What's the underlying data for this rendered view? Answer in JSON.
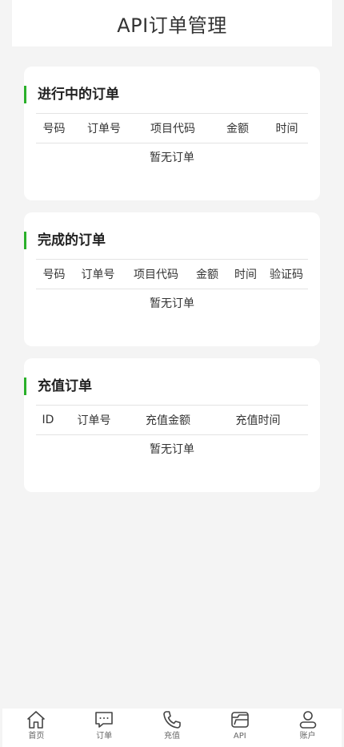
{
  "header": {
    "title": "API订单管理"
  },
  "sections": [
    {
      "title": "进行中的订单",
      "columns": [
        "号码",
        "订单号",
        "项目代码",
        "金额",
        "时间"
      ],
      "empty_text": "暂无订单"
    },
    {
      "title": "完成的订单",
      "columns": [
        "号码",
        "订单号",
        "项目代码",
        "金额",
        "时间",
        "验证码"
      ],
      "empty_text": "暂无订单"
    },
    {
      "title": "充值订单",
      "columns": [
        "ID",
        "订单号",
        "充值金额",
        "充值时间"
      ],
      "empty_text": "暂无订单"
    }
  ],
  "tabbar": {
    "items": [
      {
        "label": "首页",
        "icon": "home-icon"
      },
      {
        "label": "订单",
        "icon": "chat-icon"
      },
      {
        "label": "充值",
        "icon": "phone-icon"
      },
      {
        "label": "API",
        "icon": "folder-icon"
      },
      {
        "label": "账户",
        "icon": "user-icon"
      }
    ]
  },
  "colors": {
    "accent": "#2ab02a",
    "background": "#f4f4f4",
    "card": "#ffffff"
  }
}
